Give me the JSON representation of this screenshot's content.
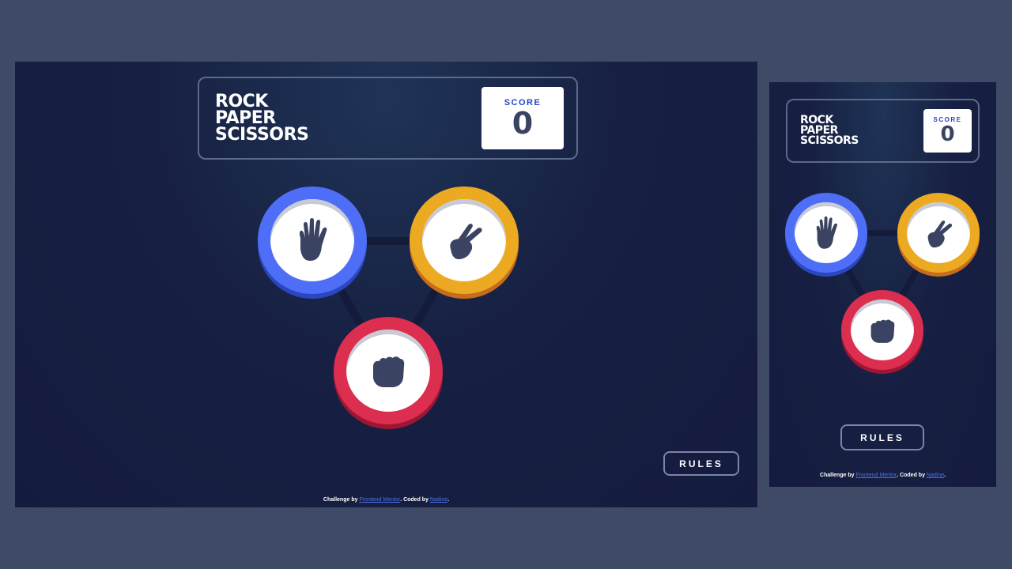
{
  "desktop": {
    "title_lines": [
      "ROCK",
      "PAPER",
      "SCISSORS"
    ],
    "score_label": "SCORE",
    "score_value": "0",
    "rules_label": "RULES",
    "attribution": {
      "prefix": "Challenge by ",
      "link1": "Frontend Mentor",
      "middle": ". Coded by ",
      "link2": "Nadine",
      "suffix": "."
    }
  },
  "mobile": {
    "title_lines": [
      "ROCK",
      "PAPER",
      "SCISSORS"
    ],
    "score_label": "SCORE",
    "score_value": "0",
    "rules_label": "RULES",
    "attribution": {
      "prefix": "Challenge by ",
      "link1": "Frontend Mentor",
      "middle": ". Coded by ",
      "link2": "Nadine",
      "suffix": "."
    }
  },
  "colors": {
    "paper": "#4f6ef7",
    "scissors": "#eca922",
    "rock": "#dc2e4e",
    "background": "#3f4a66",
    "frame": "#172042"
  },
  "icons": {
    "paper": "open-hand-icon",
    "scissors": "peace-hand-icon",
    "rock": "fist-icon"
  }
}
